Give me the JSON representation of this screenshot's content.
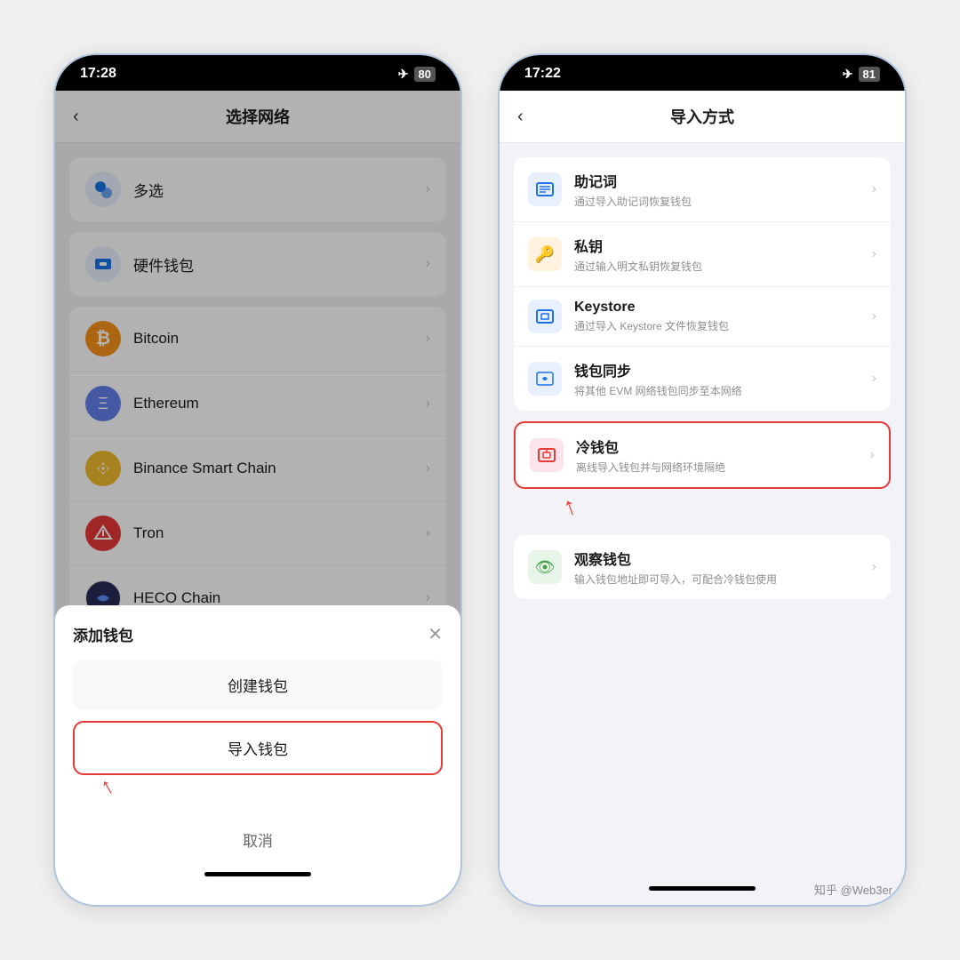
{
  "phone1": {
    "statusBar": {
      "time": "17:28",
      "battery": "80",
      "airplane": true
    },
    "header": {
      "title": "选择网络",
      "backLabel": "‹"
    },
    "networks": [
      {
        "id": "multi",
        "name": "多选",
        "iconType": "multi"
      },
      {
        "id": "hw",
        "name": "硬件钱包",
        "iconType": "hw"
      },
      {
        "id": "btc",
        "name": "Bitcoin",
        "iconType": "btc"
      },
      {
        "id": "eth",
        "name": "Ethereum",
        "iconType": "eth"
      },
      {
        "id": "bnb",
        "name": "Binance Smart Chain",
        "iconType": "bnb"
      },
      {
        "id": "tron",
        "name": "Tron",
        "iconType": "tron"
      },
      {
        "id": "heco",
        "name": "HECO Chain",
        "iconType": "heco"
      }
    ],
    "bottomSheet": {
      "title": "添加钱包",
      "closeLabel": "✕",
      "createLabel": "创建钱包",
      "importLabel": "导入钱包",
      "cancelLabel": "取消"
    }
  },
  "phone2": {
    "statusBar": {
      "time": "17:22",
      "battery": "81",
      "airplane": true
    },
    "header": {
      "title": "导入方式",
      "backLabel": "‹"
    },
    "importMethods": [
      {
        "id": "mnemonic",
        "title": "助记词",
        "desc": "通过导入助记词恢复钱包",
        "iconType": "blue",
        "iconChar": "▦"
      },
      {
        "id": "privatekey",
        "title": "私钥",
        "desc": "通过输入明文私钥恢复钱包",
        "iconType": "orange",
        "iconChar": "🔑"
      },
      {
        "id": "keystore",
        "title": "Keystore",
        "desc": "通过导入 Keystore 文件恢复钱包",
        "iconType": "blue",
        "iconChar": "▣"
      },
      {
        "id": "walletSync",
        "title": "钱包同步",
        "desc": "将其他 EVM 网络钱包同步至本网络",
        "iconType": "blue",
        "iconChar": "⟳"
      }
    ],
    "coldWallet": {
      "title": "冷钱包",
      "desc": "离线导入钱包并与网络环境隔绝",
      "iconType": "red",
      "iconChar": "▦"
    },
    "watchWallet": {
      "title": "观察钱包",
      "desc": "输入钱包地址即可导入，可配合冷钱包使用",
      "iconType": "green",
      "iconChar": "👁"
    },
    "watermark": "知乎 @Web3er"
  }
}
